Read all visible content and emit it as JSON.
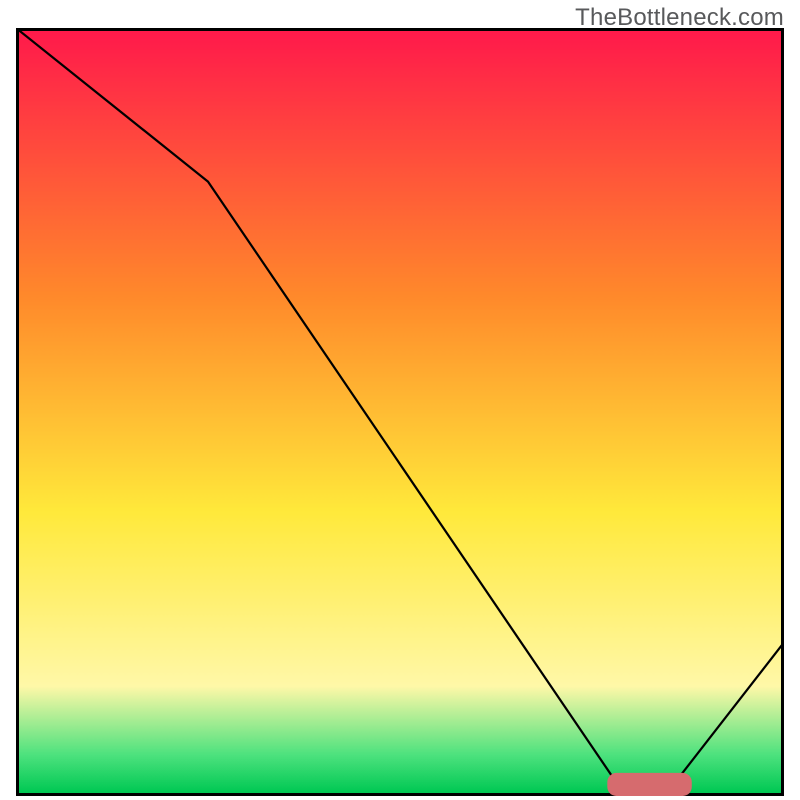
{
  "watermark": "TheBottleneck.com",
  "colors": {
    "border": "#000000",
    "line": "#000000",
    "marker": "#d66b6e",
    "grad_top": "#ff1a4b",
    "grad_orange": "#ff8a2b",
    "grad_yellow": "#ffe93b",
    "grad_paleyellow": "#fff8a8",
    "grad_green_light": "#4de27e",
    "grad_green": "#00c853"
  },
  "chart_data": {
    "type": "line",
    "title": "",
    "xlabel": "",
    "ylabel": "",
    "xlim": [
      0,
      100
    ],
    "ylim": [
      0,
      100
    ],
    "grid": false,
    "series": [
      {
        "name": "bottleneck-curve",
        "x": [
          0,
          25,
          78,
          86,
          100
        ],
        "values": [
          100,
          80,
          2,
          2,
          20
        ]
      }
    ],
    "marker": {
      "name": "optimal-region",
      "x_start": 77,
      "x_end": 88,
      "y": 1.5,
      "height": 3
    },
    "gradient_stops": [
      {
        "pos": 0.0,
        "color": "#ff1a4b"
      },
      {
        "pos": 0.35,
        "color": "#ff8a2b"
      },
      {
        "pos": 0.63,
        "color": "#ffe93b"
      },
      {
        "pos": 0.86,
        "color": "#fff8a8"
      },
      {
        "pos": 0.95,
        "color": "#4de27e"
      },
      {
        "pos": 1.0,
        "color": "#00c853"
      }
    ]
  }
}
